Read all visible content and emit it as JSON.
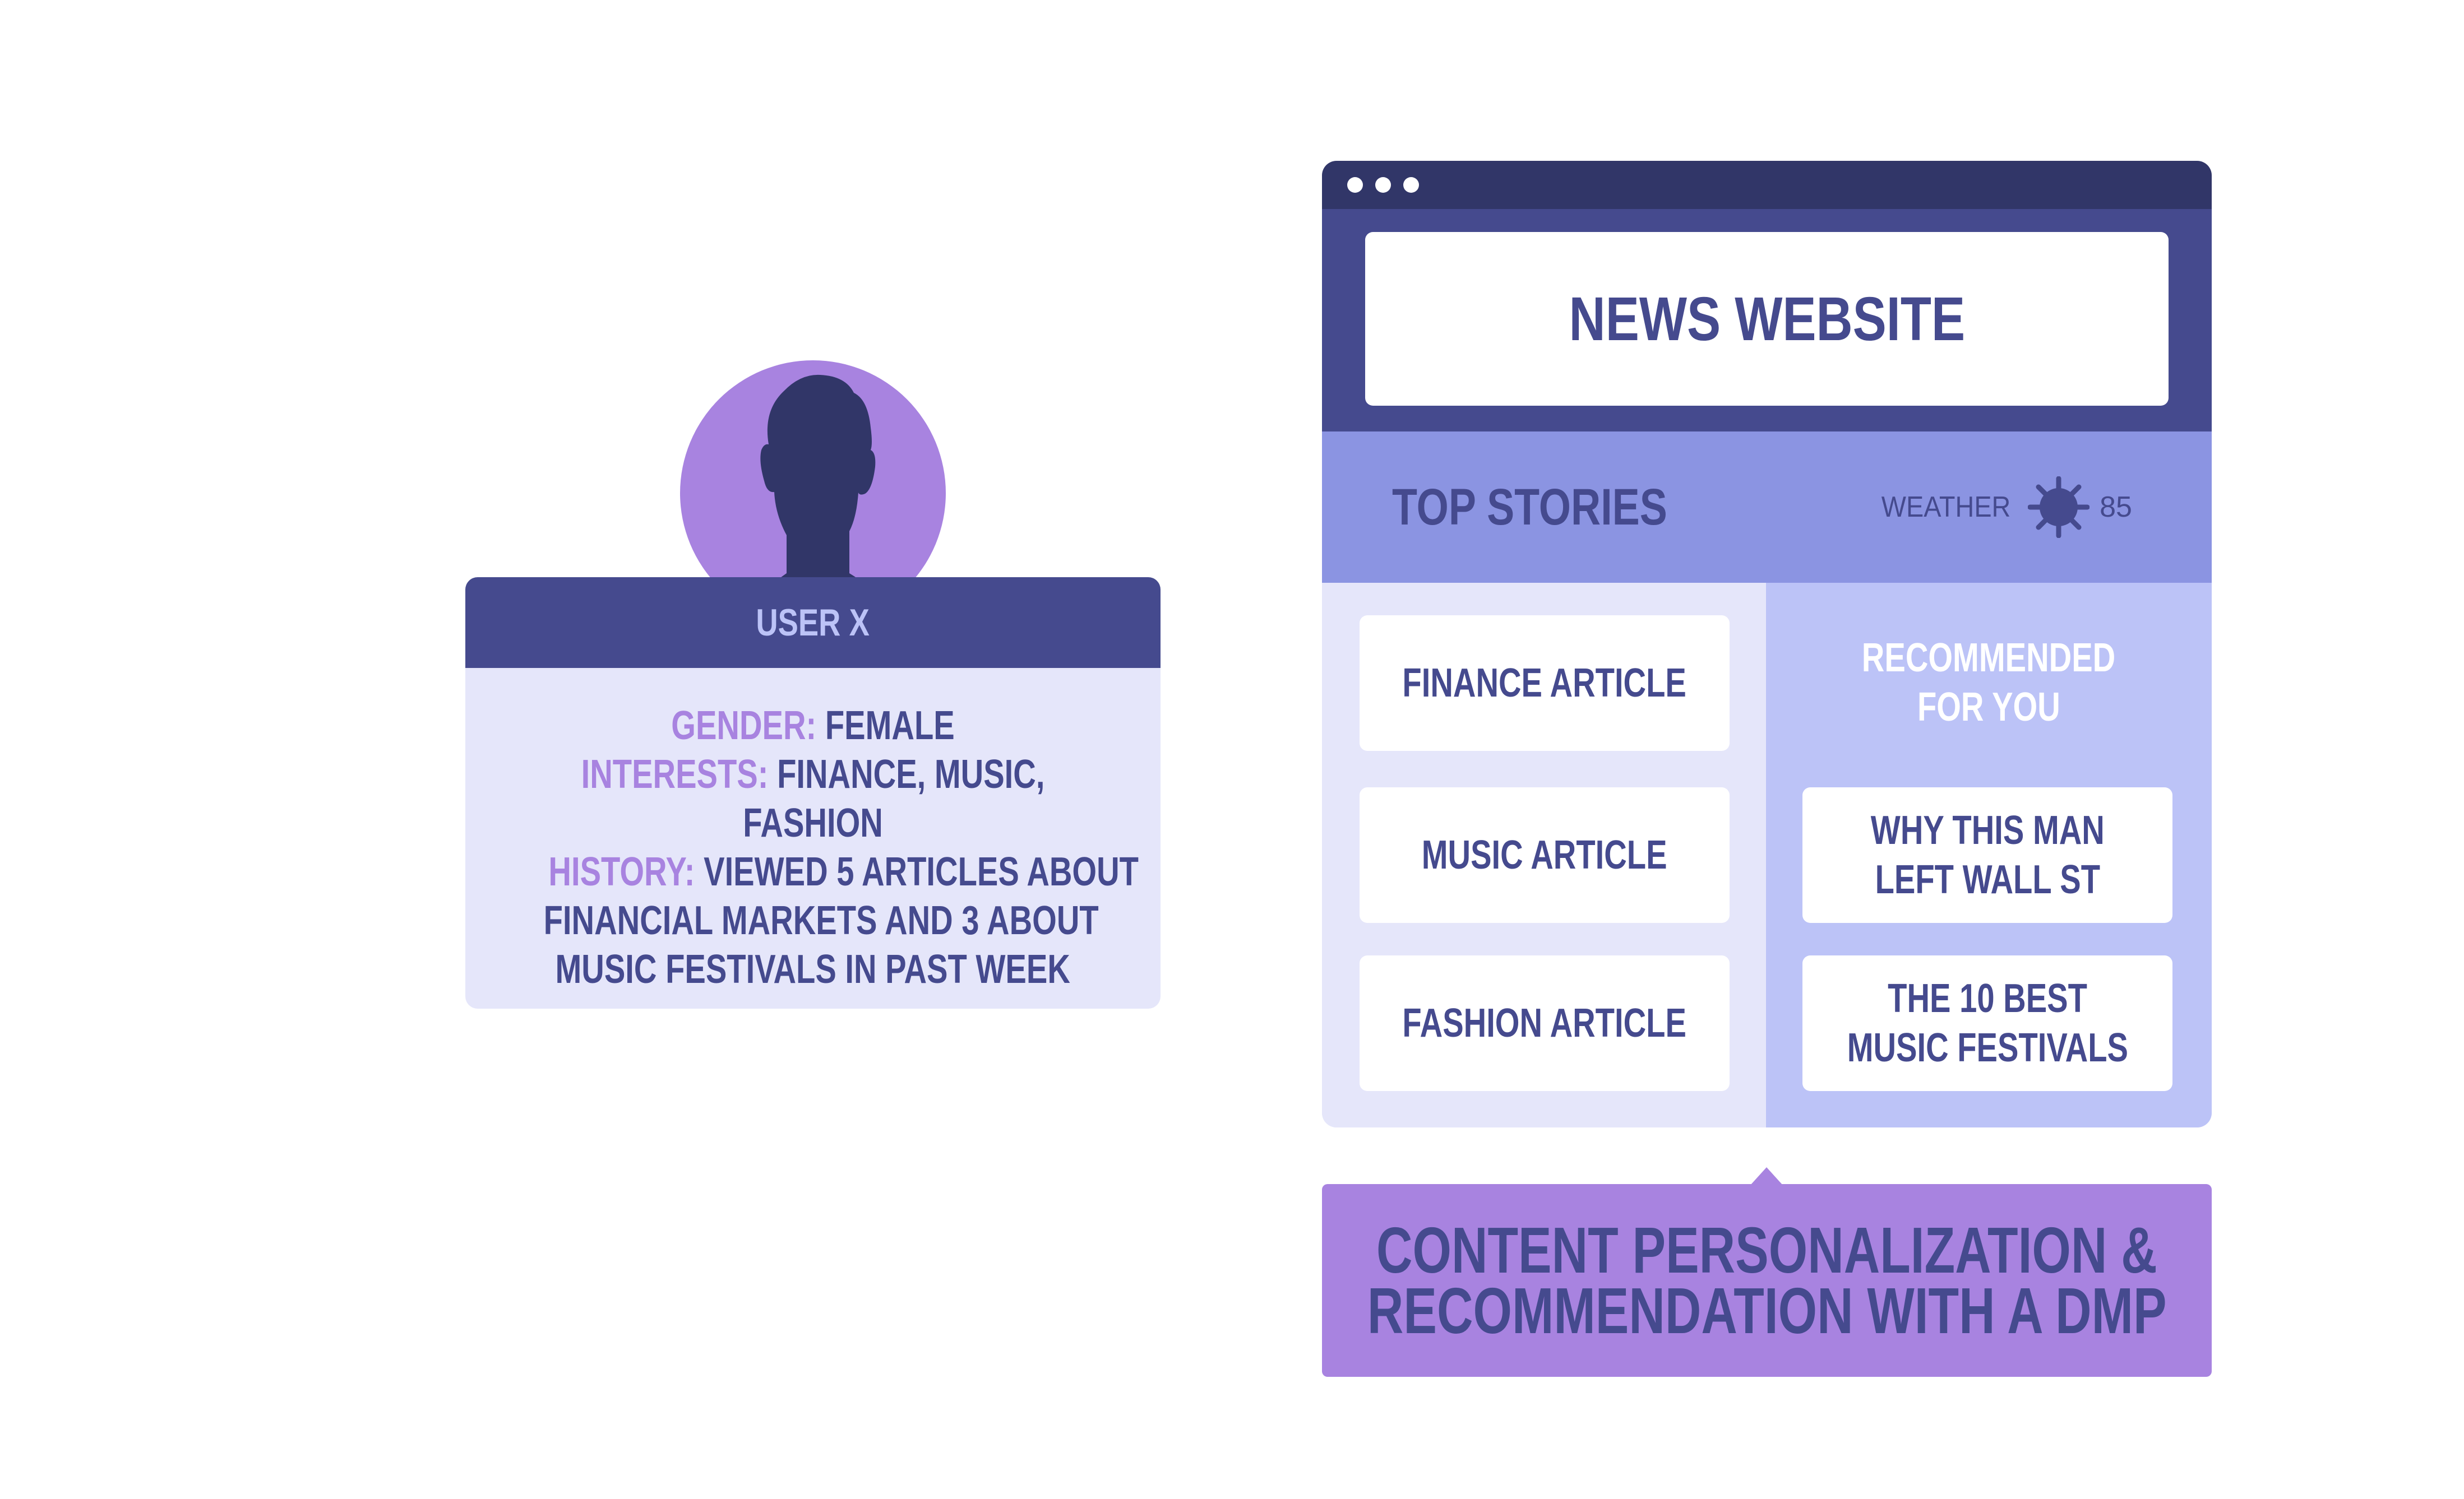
{
  "colors": {
    "navy_dark": "#313668",
    "navy": "#454a8e",
    "periwinkle": "#8b94e2",
    "lavender_light": "#e5e6fa",
    "lavender": "#bcc3f7",
    "purple_accent": "#a883e0",
    "white": "#ffffff"
  },
  "user_card": {
    "avatar_icon": "person-silhouette-icon",
    "name": "USER X",
    "attributes": [
      {
        "label": "GENDER:",
        "value_lines": [
          "FEMALE"
        ]
      },
      {
        "label": "INTERESTS:",
        "value_lines": [
          "FINANCE, MUSIC,",
          "FASHION"
        ]
      },
      {
        "label": "HISTORY:",
        "value_lines": [
          "VIEWED 5 ARTICLES ABOUT",
          "FINANCIAL MARKETS AND 3 ABOUT",
          "MUSIC FESTIVALS IN PAST WEEK"
        ]
      }
    ]
  },
  "browser": {
    "window_dots": 3,
    "site_title": "NEWS WEBSITE",
    "section_title": "TOP STORIES",
    "weather": {
      "label": "WEATHER",
      "icon": "sun-icon",
      "temperature": "85"
    },
    "top_stories": [
      {
        "title": "FINANCE ARTICLE"
      },
      {
        "title": "MUSIC ARTICLE"
      },
      {
        "title": "FASHION ARTICLE"
      }
    ],
    "recommended": {
      "title_lines": [
        "RECOMMENDED",
        "FOR YOU"
      ],
      "items": [
        {
          "title_lines": [
            "WHY THIS MAN",
            "LEFT WALL ST"
          ]
        },
        {
          "title_lines": [
            "THE 10 BEST",
            "MUSIC FESTIVALS"
          ]
        }
      ]
    }
  },
  "callout": {
    "lines": [
      "CONTENT PERSONALIZATION &",
      "RECOMMENDATION WITH A DMP"
    ]
  }
}
